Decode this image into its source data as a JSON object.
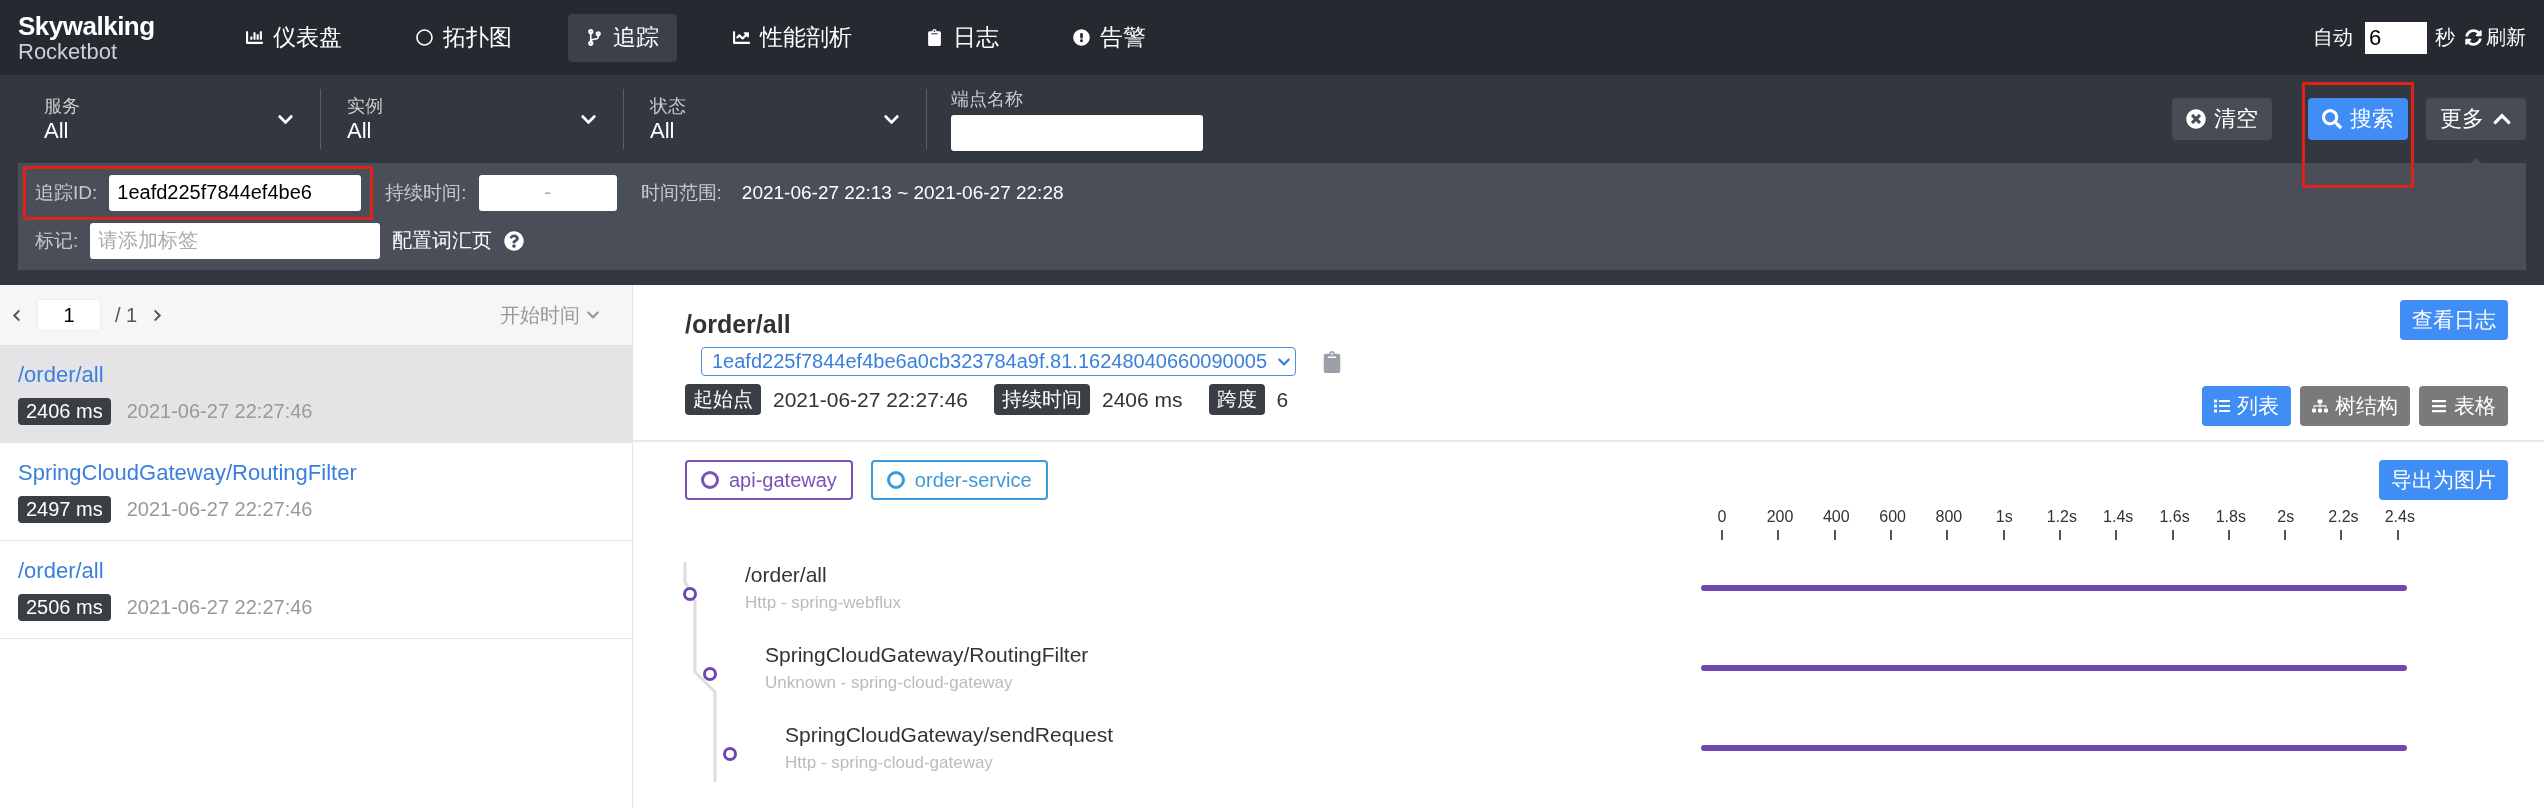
{
  "nav": {
    "logo": {
      "brand": "Skywalking",
      "product": "Rocketbot"
    },
    "items": [
      {
        "label": "仪表盘",
        "kind": "chart",
        "selected": false
      },
      {
        "label": "拓扑图",
        "kind": "topology",
        "selected": false
      },
      {
        "label": "追踪",
        "kind": "branch",
        "selected": true
      },
      {
        "label": "性能剖析",
        "kind": "line",
        "selected": false
      },
      {
        "label": "日志",
        "kind": "clipboard",
        "selected": false
      },
      {
        "label": "告警",
        "kind": "alert",
        "selected": false
      }
    ],
    "auto": {
      "label": "自动",
      "interval": "6",
      "unit": "秒"
    },
    "refresh": "刷新"
  },
  "filters": {
    "selects": [
      {
        "label": "服务",
        "value": "All"
      },
      {
        "label": "实例",
        "value": "All"
      },
      {
        "label": "状态",
        "value": "All"
      }
    ],
    "endpoint": {
      "label": "端点名称"
    },
    "clear": "清空",
    "search": {
      "label": "搜索",
      "highlighted": true
    },
    "more": {
      "label": "更多",
      "expanded": true
    },
    "trace_id": {
      "label": "追踪ID:",
      "value": "1eafd225f7844ef4be6",
      "highlighted": true
    },
    "duration": {
      "label": "持续时间:",
      "placeholder": "-"
    },
    "time_range": {
      "label": "时间范围:",
      "value": "2021-06-27 22:13 ~ 2021-06-27 22:28"
    },
    "tag": {
      "label": "标记:",
      "placeholder": "请添加标签"
    },
    "vocab_link": "配置词汇页"
  },
  "trace_list": {
    "pager": {
      "page": "1",
      "total": "/ 1"
    },
    "sort": "开始时间",
    "traces": [
      {
        "endpoint": "/order/all",
        "duration": "2406 ms",
        "start": "2021-06-27 22:27:46",
        "selected": true
      },
      {
        "endpoint": "SpringCloudGateway/RoutingFilter",
        "duration": "2497 ms",
        "start": "2021-06-27 22:27:46",
        "selected": false
      },
      {
        "endpoint": "/order/all",
        "duration": "2506 ms",
        "start": "2021-06-27 22:27:46",
        "selected": false
      }
    ]
  },
  "detail": {
    "title": "/order/all",
    "trace_id": "1eafd225f7844ef4be6a0cb323784a9f.81.16248040660090005",
    "meta": [
      {
        "label": "起始点",
        "value": "2021-06-27 22:27:46"
      },
      {
        "label": "持续时间",
        "value": "2406 ms"
      },
      {
        "label": "跨度",
        "value": "6"
      }
    ],
    "log_button": "查看日志",
    "views": [
      {
        "label": "列表",
        "kind": "list",
        "selected": true
      },
      {
        "label": "树结构",
        "kind": "tree",
        "selected": false
      },
      {
        "label": "表格",
        "kind": "table",
        "selected": false
      }
    ],
    "services": [
      {
        "name": "api-gateway",
        "color": "#7a52b3"
      },
      {
        "name": "order-service",
        "color": "#3d9ad6"
      }
    ],
    "export": "导出为图片",
    "ticks": [
      "0",
      "200",
      "400",
      "600",
      "800",
      "1s",
      "1.2s",
      "1.4s",
      "1.6s",
      "1.8s",
      "2s",
      "2.2s",
      "2.4s"
    ],
    "spans": [
      {
        "endpoint": "/order/all",
        "type": "Http - spring-webflux",
        "children": [
          {
            "endpoint": "SpringCloudGateway/RoutingFilter",
            "type": "Unknown - spring-cloud-gateway",
            "children": [
              {
                "endpoint": "SpringCloudGateway/sendRequest",
                "type": "Http - spring-cloud-gateway"
              }
            ]
          }
        ]
      }
    ]
  }
}
